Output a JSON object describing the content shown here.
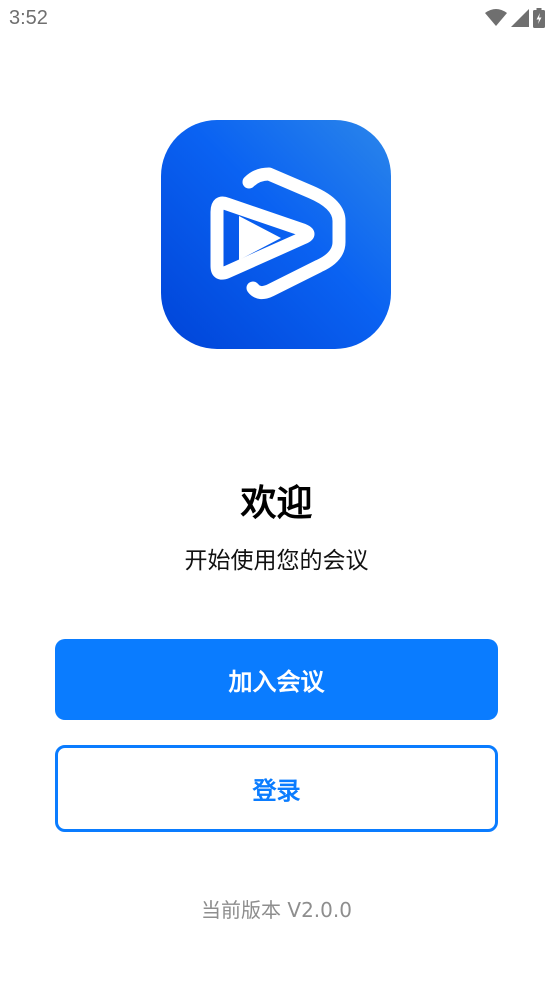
{
  "status_bar": {
    "time": "3:52",
    "icons": [
      "wifi-icon",
      "signal-icon",
      "battery-charging-icon"
    ]
  },
  "branding": {
    "logo": "app-logo-play-icon",
    "colors": {
      "gradient_start": "#2b86ea",
      "gradient_end": "#0044d8",
      "glyph": "#ffffff"
    }
  },
  "welcome": {
    "title": "欢迎",
    "subtitle": "开始使用您的会议"
  },
  "actions": {
    "join_label": "加入会议",
    "login_label": "登录",
    "accent_color": "#0a7cff"
  },
  "footer": {
    "version": "当前版本 V2.0.0"
  }
}
